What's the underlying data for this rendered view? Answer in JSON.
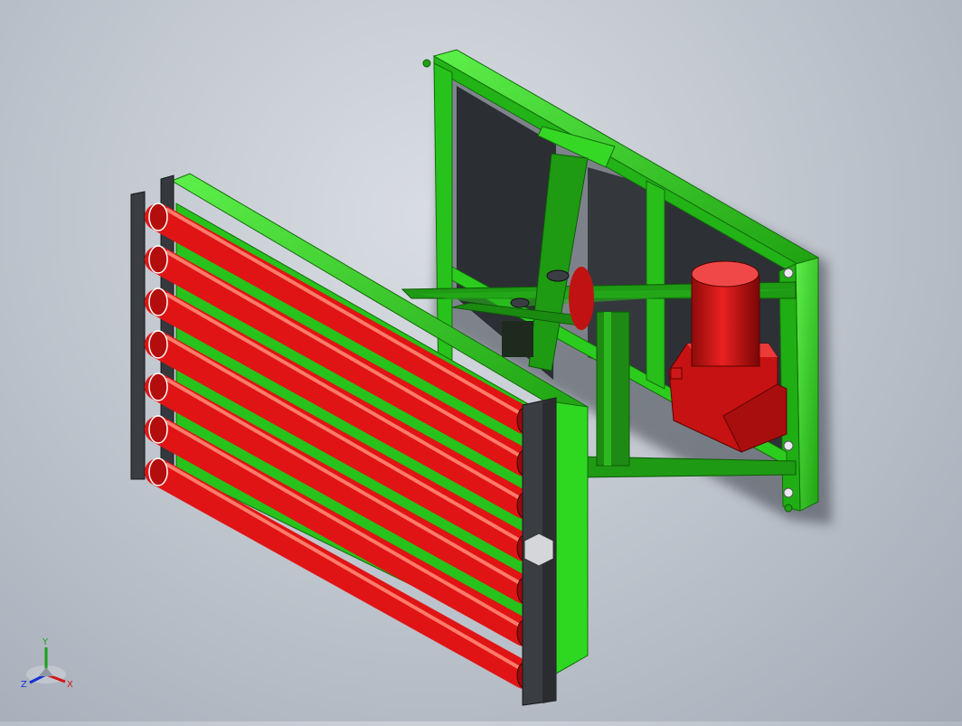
{
  "viewport": {
    "background_top": "#d9dde3",
    "background_bottom": "#a3abb7",
    "model": {
      "frame_color": "#2fd21f",
      "frame_dark": "#1f9a14",
      "roller_color": "#e01414",
      "roller_dark": "#8f0808",
      "panel_color": "#2b2f33",
      "plate_color": "#3a3d42",
      "motor_color": "#d41010",
      "roller_count": 7
    }
  },
  "triad": {
    "x_label": "X",
    "y_label": "Y",
    "z_label": "Z",
    "x_color": "#d01818",
    "y_color": "#18a018",
    "z_color": "#1830d0"
  }
}
